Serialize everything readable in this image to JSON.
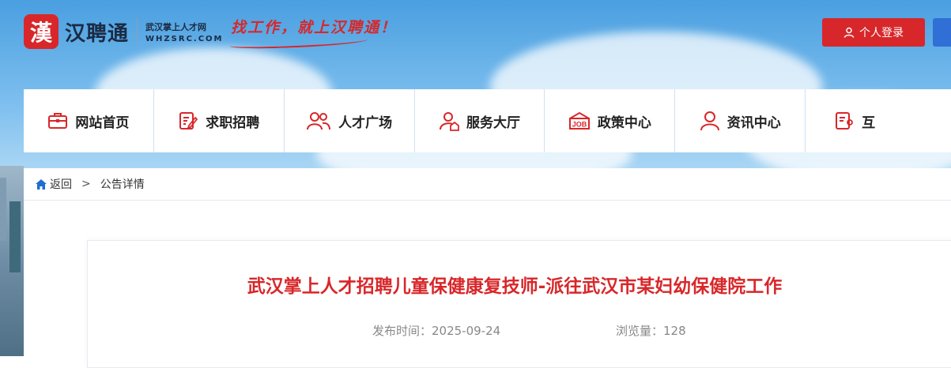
{
  "header": {
    "logo_mark": "漢",
    "logo_name": "汉聘通",
    "logo_sub_cn": "武汉掌上人才网",
    "logo_sub_en": "WHZSRC.COM",
    "slogan": "找工作，就上汉聘通！",
    "login_label": "个人登录"
  },
  "nav": {
    "items": [
      {
        "label": "网站首页",
        "icon": "briefcase-icon"
      },
      {
        "label": "求职招聘",
        "icon": "edit-doc-icon"
      },
      {
        "label": "人才广场",
        "icon": "people-icon"
      },
      {
        "label": "服务大厅",
        "icon": "user-home-icon"
      },
      {
        "label": "政策中心",
        "icon": "job-icon"
      },
      {
        "label": "资讯中心",
        "icon": "user-icon"
      }
    ],
    "partial_item_label": "互"
  },
  "breadcrumb": {
    "back_label": "返回",
    "separator": ">",
    "current": "公告详情"
  },
  "article": {
    "title": "武汉掌上人才招聘儿童保健康复技师-派往武汉市某妇幼保健院工作",
    "publish_time": "发布时间：2025-09-24",
    "views": "浏览量：128"
  },
  "colors": {
    "brand_red": "#d8272a",
    "nav_divider": "#cfe1f1"
  }
}
